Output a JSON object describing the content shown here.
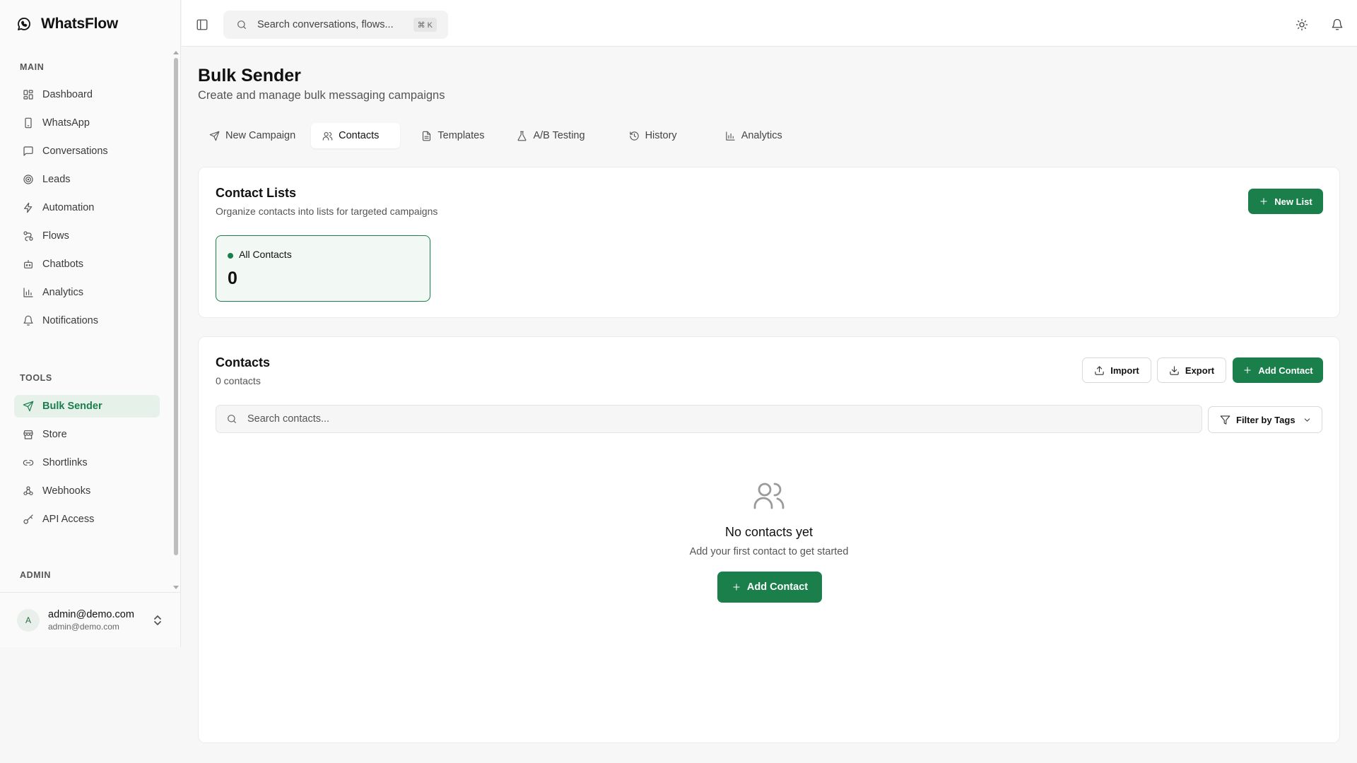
{
  "app": {
    "name": "WhatsFlow"
  },
  "sidebar": {
    "sections": {
      "main": "MAIN",
      "tools": "TOOLS",
      "admin": "ADMIN"
    },
    "main_items": [
      {
        "label": "Dashboard",
        "icon": "dashboard-icon"
      },
      {
        "label": "WhatsApp",
        "icon": "smartphone-icon"
      },
      {
        "label": "Conversations",
        "icon": "chat-icon"
      },
      {
        "label": "Leads",
        "icon": "target-icon"
      },
      {
        "label": "Automation",
        "icon": "lightning-icon"
      },
      {
        "label": "Flows",
        "icon": "workflow-icon"
      },
      {
        "label": "Chatbots",
        "icon": "bot-icon"
      },
      {
        "label": "Analytics",
        "icon": "bar-chart-icon"
      },
      {
        "label": "Notifications",
        "icon": "bell-icon"
      }
    ],
    "tool_items": [
      {
        "label": "Bulk Sender",
        "icon": "send-icon",
        "active": true
      },
      {
        "label": "Store",
        "icon": "store-icon"
      },
      {
        "label": "Shortlinks",
        "icon": "link-icon"
      },
      {
        "label": "Webhooks",
        "icon": "webhook-icon"
      },
      {
        "label": "API Access",
        "icon": "key-icon"
      }
    ],
    "user": {
      "initial": "A",
      "name": "admin@demo.com",
      "email": "admin@demo.com"
    }
  },
  "header": {
    "search_placeholder": "Search conversations, flows...",
    "shortcut": "⌘ K"
  },
  "page": {
    "title": "Bulk Sender",
    "subtitle": "Create and manage bulk messaging campaigns"
  },
  "tabs": [
    {
      "label": "New Campaign",
      "icon": "send-icon"
    },
    {
      "label": "Contacts",
      "icon": "users-icon",
      "active": true
    },
    {
      "label": "Templates",
      "icon": "document-icon"
    },
    {
      "label": "A/B Testing",
      "icon": "flask-icon"
    },
    {
      "label": "History",
      "icon": "history-icon"
    },
    {
      "label": "Analytics",
      "icon": "bar-chart-icon"
    }
  ],
  "contact_lists": {
    "title": "Contact Lists",
    "subtitle": "Organize contacts into lists for targeted campaigns",
    "new_list_label": "New List",
    "lists": [
      {
        "name": "All Contacts",
        "count": "0"
      }
    ]
  },
  "contacts": {
    "title": "Contacts",
    "count_text": "0 contacts",
    "import_label": "Import",
    "export_label": "Export",
    "add_label": "Add Contact",
    "search_placeholder": "Search contacts...",
    "filter_label": "Filter by Tags",
    "empty": {
      "title": "No contacts yet",
      "subtitle": "Add your first contact to get started",
      "button_label": "Add Contact"
    }
  },
  "colors": {
    "accent": "#1a7f4b",
    "accent_light": "#e6f1ea"
  }
}
